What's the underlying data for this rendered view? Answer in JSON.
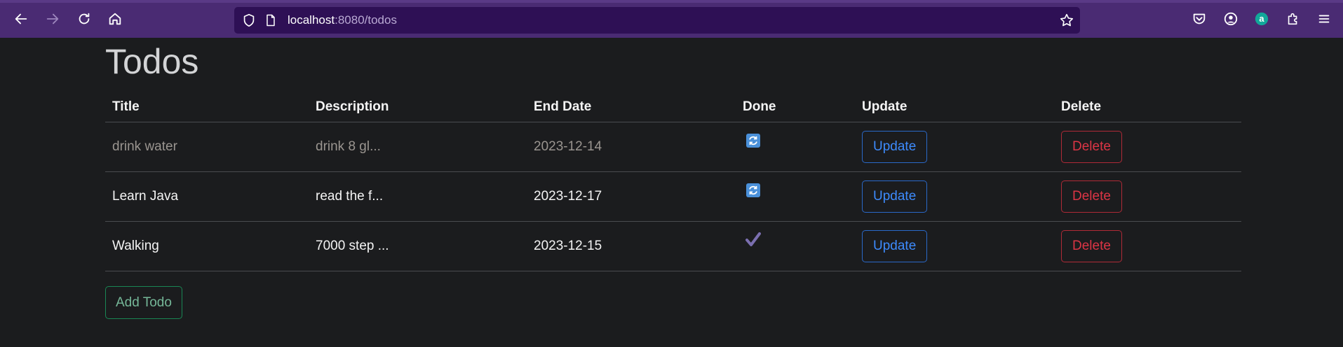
{
  "browser": {
    "url_host": "localhost",
    "url_rest": ":8080/todos",
    "extension_letter": "a"
  },
  "page": {
    "title": "Todos"
  },
  "table": {
    "headers": [
      "Title",
      "Description",
      "End Date",
      "Done",
      "Update",
      "Delete"
    ],
    "rows": [
      {
        "title": "drink water",
        "description": "drink 8 gl...",
        "end_date": "2023-12-14",
        "done_icon": "repeat-icon",
        "update_label": "Update",
        "delete_label": "Delete"
      },
      {
        "title": "Learn Java",
        "description": "read the f...",
        "end_date": "2023-12-17",
        "done_icon": "repeat-icon",
        "update_label": "Update",
        "delete_label": "Delete"
      },
      {
        "title": "Walking",
        "description": "7000 step ...",
        "end_date": "2023-12-15",
        "done_icon": "checkmark-icon",
        "update_label": "Update",
        "delete_label": "Delete"
      }
    ]
  },
  "actions": {
    "add_label": "Add Todo"
  },
  "colors": {
    "background": "#1b1c1e",
    "toolbar": "#4a2b73",
    "urlbar": "#2e1055",
    "primary": "#3d8bfd",
    "danger": "#dc3545",
    "success": "#75b798"
  }
}
